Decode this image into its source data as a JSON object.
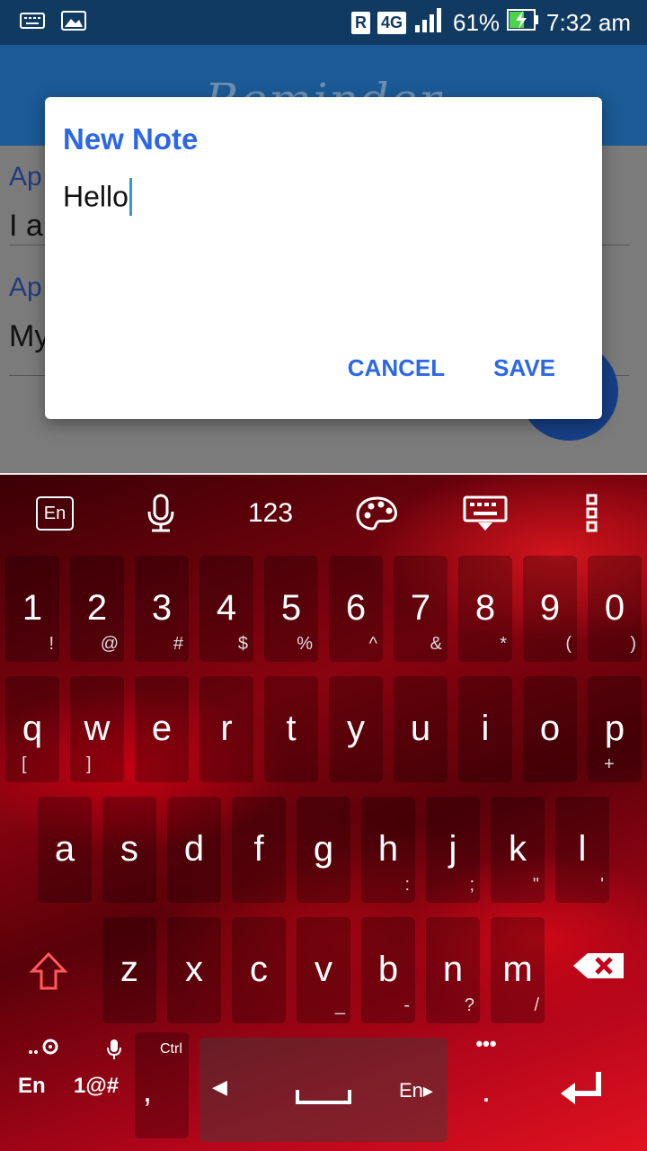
{
  "status": {
    "r_badge": "R",
    "network": "4G",
    "battery": "61%",
    "time": "7:32 am"
  },
  "appbar": {
    "title": "Reminder"
  },
  "list": [
    {
      "date": "Ap",
      "text": "I a"
    },
    {
      "date": "Ap",
      "text": "My"
    }
  ],
  "dialog": {
    "title": "New Note",
    "input_value": "Hello",
    "cancel": "CANCEL",
    "save": "SAVE"
  },
  "keyboard": {
    "toolbar": {
      "lang": "En",
      "numbers": "123"
    },
    "row1": [
      {
        "m": "1",
        "s": "!"
      },
      {
        "m": "2",
        "s": "@"
      },
      {
        "m": "3",
        "s": "#"
      },
      {
        "m": "4",
        "s": "$"
      },
      {
        "m": "5",
        "s": "%"
      },
      {
        "m": "6",
        "s": "^"
      },
      {
        "m": "7",
        "s": "&"
      },
      {
        "m": "8",
        "s": "*"
      },
      {
        "m": "9",
        "s": "("
      },
      {
        "m": "0",
        "s": ")"
      }
    ],
    "row2": [
      {
        "m": "q",
        "s": "["
      },
      {
        "m": "w",
        "s": "]"
      },
      {
        "m": "e",
        "s": ""
      },
      {
        "m": "r",
        "s": ""
      },
      {
        "m": "t",
        "s": ""
      },
      {
        "m": "y",
        "s": ""
      },
      {
        "m": "u",
        "s": ""
      },
      {
        "m": "i",
        "s": ""
      },
      {
        "m": "o",
        "s": ""
      },
      {
        "m": "p",
        "s": "+"
      }
    ],
    "row3": [
      {
        "m": "a",
        "s": ""
      },
      {
        "m": "s",
        "s": ""
      },
      {
        "m": "d",
        "s": ""
      },
      {
        "m": "f",
        "s": ""
      },
      {
        "m": "g",
        "s": ""
      },
      {
        "m": "h",
        "s": ":"
      },
      {
        "m": "j",
        "s": ";"
      },
      {
        "m": "k",
        "s": "\""
      },
      {
        "m": "l",
        "s": "'"
      }
    ],
    "row4": [
      {
        "m": "z",
        "s": ""
      },
      {
        "m": "x",
        "s": ""
      },
      {
        "m": "c",
        "s": ""
      },
      {
        "m": "v",
        "s": "_"
      },
      {
        "m": "b",
        "s": "-"
      },
      {
        "m": "n",
        "s": "?"
      },
      {
        "m": "m",
        "s": "/"
      }
    ],
    "bottom": {
      "lang": "En",
      "symbols": "1@#",
      "ctrl": "Ctrl",
      "comma": ",",
      "space_lang": "En",
      "period": "."
    }
  },
  "colors": {
    "statusbar": "#113a62",
    "appbar": "#1b5a95",
    "dialog_accent": "#2c67e8",
    "caret": "#2c9cd7"
  }
}
